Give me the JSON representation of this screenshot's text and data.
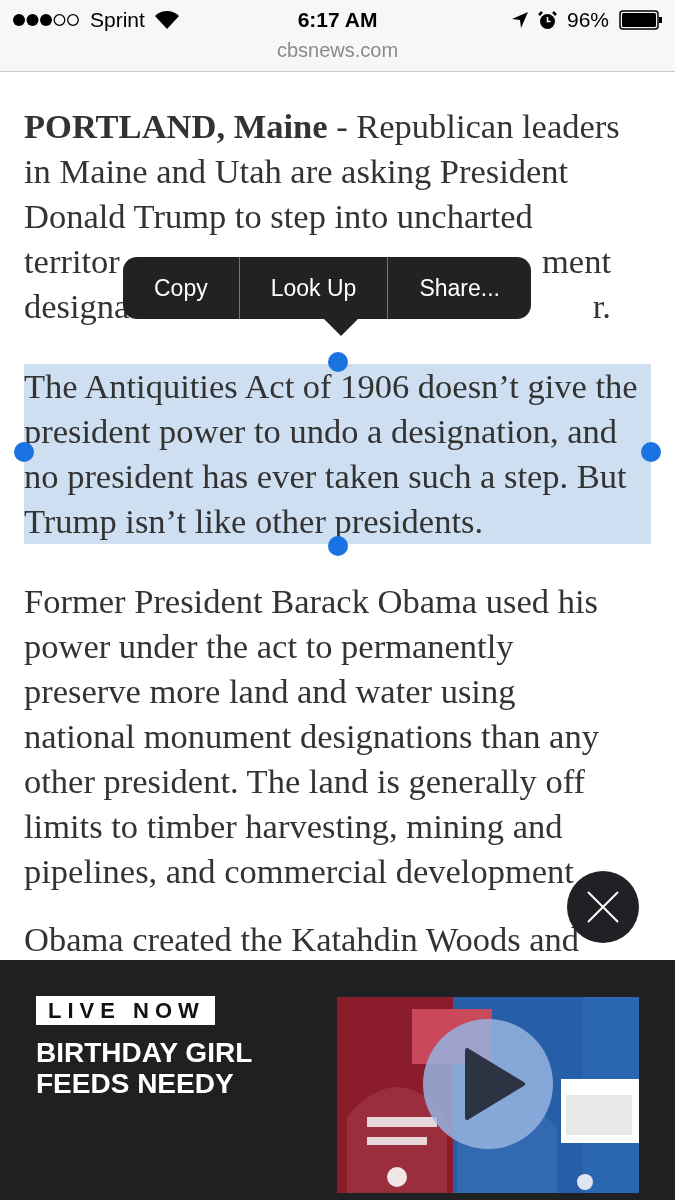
{
  "status_bar": {
    "carrier": "Sprint",
    "time": "6:17 AM",
    "battery": "96%"
  },
  "address_bar": {
    "url": "cbsnews.com"
  },
  "article": {
    "paragraphs": [
      {
        "selected": false,
        "lines": [
          [
            "**PORTLAND, Maine** - Republican leaders"
          ],
          [
            "in Maine and Utah are asking President"
          ],
          [
            "Donald Trump to step into uncharted"
          ],
          [
            "territor",
            "ment"
          ],
          [
            "designa",
            "r."
          ]
        ]
      },
      {
        "selected": true,
        "lines": [
          [
            "The Antiquities Act of 1906 doesn’t give the"
          ],
          [
            "president power to undo a designation, and"
          ],
          [
            "no president has ever taken such a step. But"
          ],
          [
            "Trump isn’t like other presidents."
          ]
        ]
      },
      {
        "selected": false,
        "lines": [
          [
            "Former President Barack Obama used his"
          ],
          [
            "power under the act to permanently"
          ],
          [
            "preserve more land and water using"
          ],
          [
            "national monument designations than any"
          ],
          [
            "other president. The land is generally off"
          ],
          [
            "limits to timber harvesting, mining and"
          ],
          [
            "pipelines, and commercial development"
          ]
        ]
      },
      {
        "selected": false,
        "lines": [
          [
            "Obama created the Katahdin Woods and"
          ]
        ]
      }
    ]
  },
  "context_menu": [
    "Copy",
    "Look Up",
    "Share..."
  ],
  "live_banner": {
    "badge": "LIVE NOW",
    "headline": [
      "BIRTHDAY GIRL",
      "FEEDS NEEDY"
    ]
  }
}
